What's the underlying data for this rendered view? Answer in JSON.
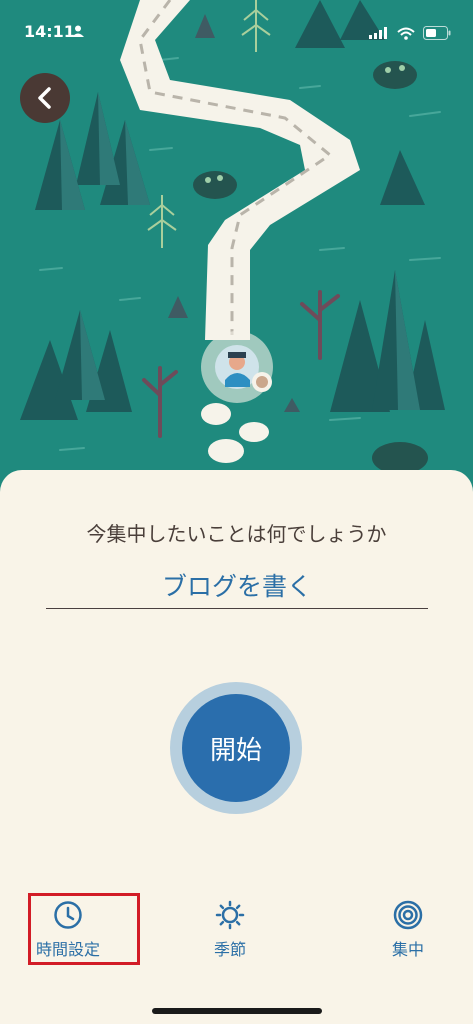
{
  "status_bar": {
    "time": "14:11"
  },
  "main": {
    "question": "今集中したいことは何でしょうか",
    "task_value": "ブログを書く",
    "start_label": "開始"
  },
  "tabbar": {
    "time_settings": "時間設定",
    "season": "季節",
    "focus": "集中"
  },
  "colors": {
    "map_background": "#1f8a7e",
    "sheet_background": "#f9f4e8",
    "accent_blue": "#2a6ead",
    "highlight_red": "#d21c26"
  }
}
